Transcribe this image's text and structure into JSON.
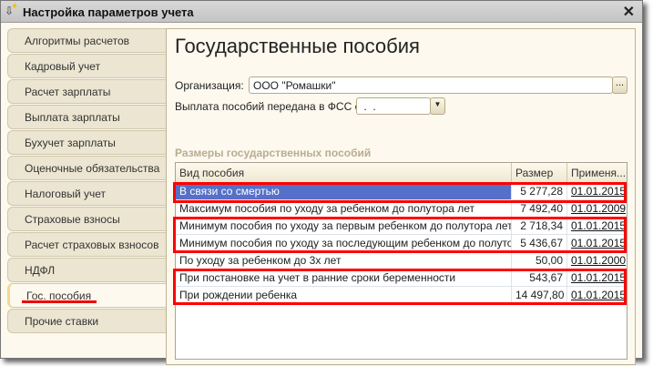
{
  "window": {
    "title": "Настройка параметров учета"
  },
  "tabs": [
    "Алгоритмы расчетов",
    "Кадровый учет",
    "Расчет зарплаты",
    "Выплата зарплаты",
    "Бухучет зарплаты",
    "Оценочные обязательства",
    "Налоговый учет",
    "Страховые взносы",
    "Расчет страховых взносов",
    "НДФЛ",
    "Гос. пособия",
    "Прочие ставки"
  ],
  "active_tab": "Гос. пособия",
  "page": {
    "title": "Государственные пособия",
    "org_label": "Организация:",
    "org_value": "ООО \"Ромашки\"",
    "select_button": "...",
    "fss_label": "Выплата пособий передана в ФСС с:",
    "fss_value": " .  . ",
    "section": "Размеры государственных пособий"
  },
  "table": {
    "headers": [
      "Вид пособия",
      "Размер",
      "Применя..."
    ],
    "rows": [
      {
        "name": "В связи со смертью",
        "size": "5 277,28",
        "date": "01.01.2015"
      },
      {
        "name": "Максимум пособия по уходу за ребенком до полутора лет",
        "size": "7 492,40",
        "date": "01.01.2009"
      },
      {
        "name": "Минимум пособия по уходу за первым ребенком до полутора лет",
        "size": "2 718,34",
        "date": "01.01.2015"
      },
      {
        "name": "Минимум пособия по уходу за последующим ребенком до полутора ...",
        "size": "5 436,67",
        "date": "01.01.2015"
      },
      {
        "name": "По уходу за ребенком до 3х лет",
        "size": "50,00",
        "date": "01.01.2000"
      },
      {
        "name": "При постановке на учет в ранние сроки беременности",
        "size": "543,67",
        "date": "01.01.2015"
      },
      {
        "name": "При рождении ребенка",
        "size": "14 497,80",
        "date": "01.01.2015"
      }
    ]
  },
  "colors": {
    "highlight": "#ff0000",
    "selection": "#5470c8"
  }
}
